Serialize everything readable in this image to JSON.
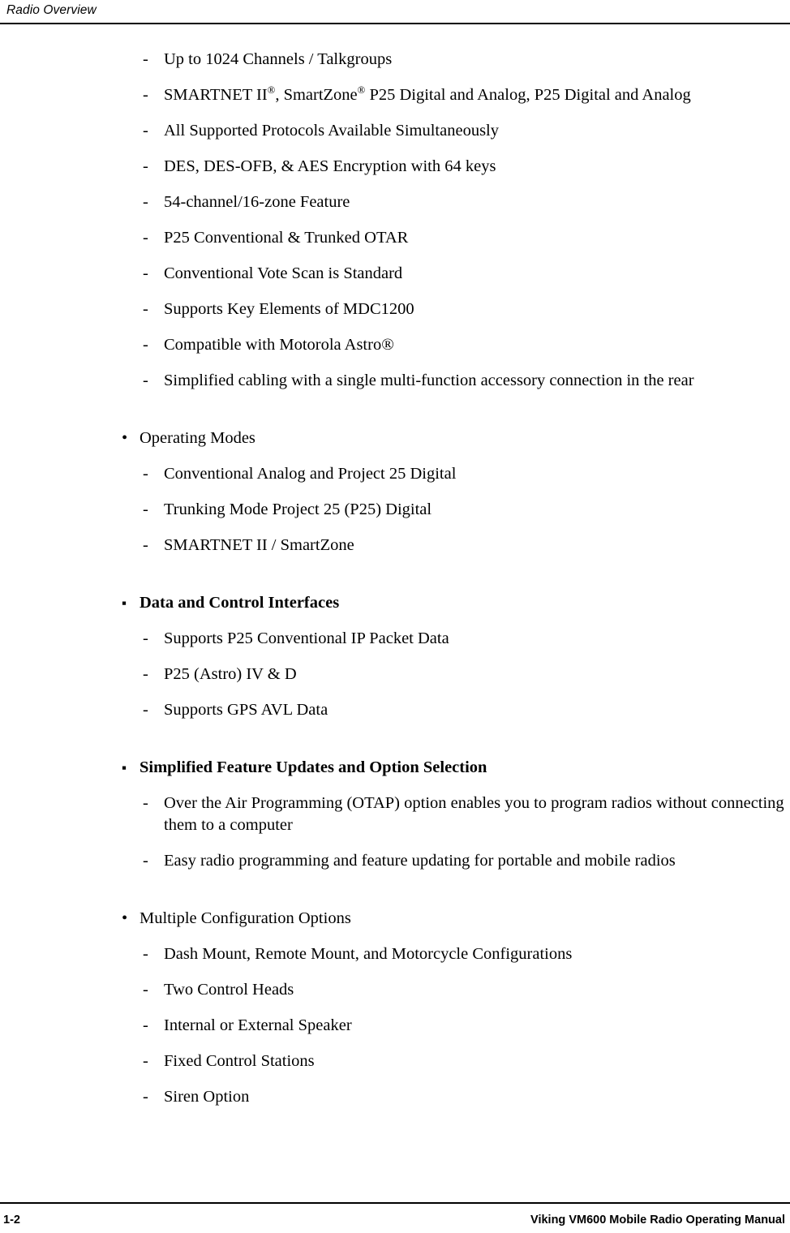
{
  "header": {
    "title": "Radio Overview"
  },
  "footer": {
    "page_number": "1-2",
    "manual_title": "Viking VM600 Mobile Radio Operating Manual"
  },
  "bullet_glyphs": {
    "round": "•",
    "square": "▪",
    "dash": "-"
  },
  "content": [
    {
      "level": 2,
      "text": "Up to 1024 Channels / Talkgroups"
    },
    {
      "level": 2,
      "html": "SMARTNET II<sup>®</sup>, SmartZone<sup>®</sup> P25 Digital and Analog, P25 Digital and Analog",
      "text": "SMARTNET II®, SmartZone® P25 Digital and Analog, P25 Digital and Analog"
    },
    {
      "level": 2,
      "text": "All Supported Protocols Available Simultaneously"
    },
    {
      "level": 2,
      "text": "DES, DES-OFB, & AES Encryption with 64 keys"
    },
    {
      "level": 2,
      "text": "54-channel/16-zone Feature"
    },
    {
      "level": 2,
      "text": "P25 Conventional & Trunked OTAR"
    },
    {
      "level": 2,
      "text": "Conventional Vote Scan is Standard"
    },
    {
      "level": 2,
      "text": "Supports Key Elements of MDC1200"
    },
    {
      "level": 2,
      "text": "Compatible with Motorola Astro®"
    },
    {
      "level": 2,
      "text": "Simplified cabling with a single multi-function accessory connection in the rear"
    },
    {
      "level": 1,
      "bold": false,
      "text": "Operating Modes"
    },
    {
      "level": 2,
      "text": "Conventional Analog and Project 25 Digital"
    },
    {
      "level": 2,
      "text": "Trunking Mode Project 25 (P25) Digital"
    },
    {
      "level": 2,
      "text": "SMARTNET II / SmartZone"
    },
    {
      "level": 1,
      "bold": true,
      "text": "Data and Control Interfaces"
    },
    {
      "level": 2,
      "text": "Supports P25 Conventional IP Packet Data"
    },
    {
      "level": 2,
      "text": "P25 (Astro) IV & D"
    },
    {
      "level": 2,
      "text": "Supports GPS AVL Data"
    },
    {
      "level": 1,
      "bold": true,
      "text": "Simplified Feature Updates and Option Selection"
    },
    {
      "level": 2,
      "text": "Over the Air Programming (OTAP) option enables you to program radios without connecting them to a computer"
    },
    {
      "level": 2,
      "text": "Easy radio programming and feature updating for portable and mobile radios"
    },
    {
      "level": 1,
      "bold": false,
      "text": "Multiple Configuration Options"
    },
    {
      "level": 2,
      "text": "Dash Mount, Remote Mount, and Motorcycle Configurations"
    },
    {
      "level": 2,
      "text": "Two Control Heads"
    },
    {
      "level": 2,
      "text": "Internal or External Speaker"
    },
    {
      "level": 2,
      "text": "Fixed Control Stations"
    },
    {
      "level": 2,
      "text": "Siren Option"
    }
  ]
}
